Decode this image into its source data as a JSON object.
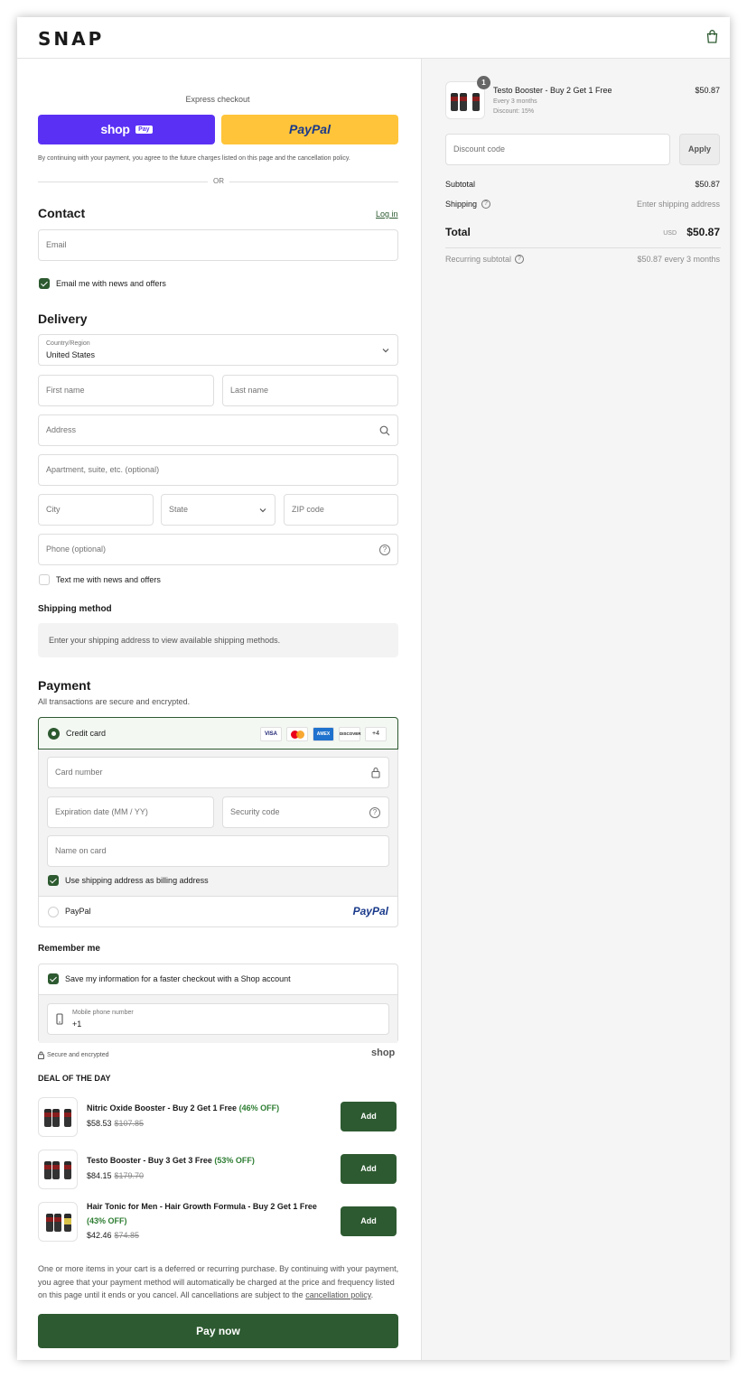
{
  "header": {
    "logo": "SNAP"
  },
  "express": {
    "title": "Express checkout",
    "shop_pay": "shop",
    "shop_pay_badge": "Pay",
    "paypal": "PayPal",
    "disclaimer": "By continuing with your payment, you agree to the future charges listed on this page and the cancellation policy.",
    "or": "OR"
  },
  "contact": {
    "heading": "Contact",
    "login": "Log in",
    "email_placeholder": "Email",
    "news_label": "Email me with news and offers",
    "news_checked": true
  },
  "delivery": {
    "heading": "Delivery",
    "country_label": "Country/Region",
    "country_value": "United States",
    "first_name": "First name",
    "last_name": "Last name",
    "address": "Address",
    "apartment": "Apartment, suite, etc. (optional)",
    "city": "City",
    "state": "State",
    "zip": "ZIP code",
    "phone": "Phone (optional)",
    "text_label": "Text me with news and offers",
    "text_checked": false
  },
  "shipping_method": {
    "heading": "Shipping method",
    "notice": "Enter your shipping address to view available shipping methods."
  },
  "payment": {
    "heading": "Payment",
    "subtitle": "All transactions are secure and encrypted.",
    "credit_card": "Credit card",
    "cards": [
      "VISA",
      "MC",
      "AMEX",
      "DISCOVER"
    ],
    "more_cards": "+4",
    "card_number": "Card number",
    "expiration": "Expiration date (MM / YY)",
    "security_code": "Security code",
    "name_on_card": "Name on card",
    "billing_label": "Use shipping address as billing address",
    "billing_checked": true,
    "paypal": "PayPal",
    "paypal_logo": "PayPal"
  },
  "remember": {
    "heading": "Remember me",
    "save_label": "Save my information for a faster checkout with a Shop account",
    "save_checked": true,
    "mobile_label": "Mobile phone number",
    "mobile_value": "+1",
    "secure": "Secure and encrypted",
    "shop": "shop"
  },
  "deal": {
    "heading": "DEAL OF THE DAY",
    "items": [
      {
        "name": "Nitric Oxide Booster - Buy 2 Get 1 Free",
        "discount": "(46% OFF)",
        "price": "$58.53",
        "old_price": "$107.85",
        "button": "Add"
      },
      {
        "name": "Testo Booster - Buy 3 Get 3 Free",
        "discount": "(53% OFF)",
        "price": "$84.15",
        "old_price": "$179.70",
        "button": "Add"
      },
      {
        "name": "Hair Tonic for Men - Hair Growth Formula - Buy 2 Get 1 Free",
        "discount": "(43% OFF)",
        "price": "$42.46",
        "old_price": "$74.85",
        "button": "Add"
      }
    ]
  },
  "footer": {
    "terms": "One or more items in your cart is a deferred or recurring purchase. By continuing with your payment, you agree that your payment method will automatically be charged at the price and frequency listed on this page until it ends or you cancel. All cancellations are subject to the",
    "terms_link": "cancellation policy",
    "terms_end": ".",
    "pay_now": "Pay now"
  },
  "summary": {
    "item": {
      "quantity": "1",
      "name": "Testo Booster - Buy 2 Get 1 Free",
      "frequency": "Every 3 months",
      "discount": "Discount: 15%",
      "price": "$50.87"
    },
    "discount_placeholder": "Discount code",
    "apply": "Apply",
    "subtotal_label": "Subtotal",
    "subtotal_value": "$50.87",
    "shipping_label": "Shipping",
    "shipping_value": "Enter shipping address",
    "total_label": "Total",
    "currency": "USD",
    "total_value": "$50.87",
    "recurring_label": "Recurring subtotal",
    "recurring_value": "$50.87 every 3 months"
  },
  "colors": {
    "accent": "#2d5a30",
    "shop_pay": "#5a31f4",
    "paypal": "#ffc439"
  }
}
